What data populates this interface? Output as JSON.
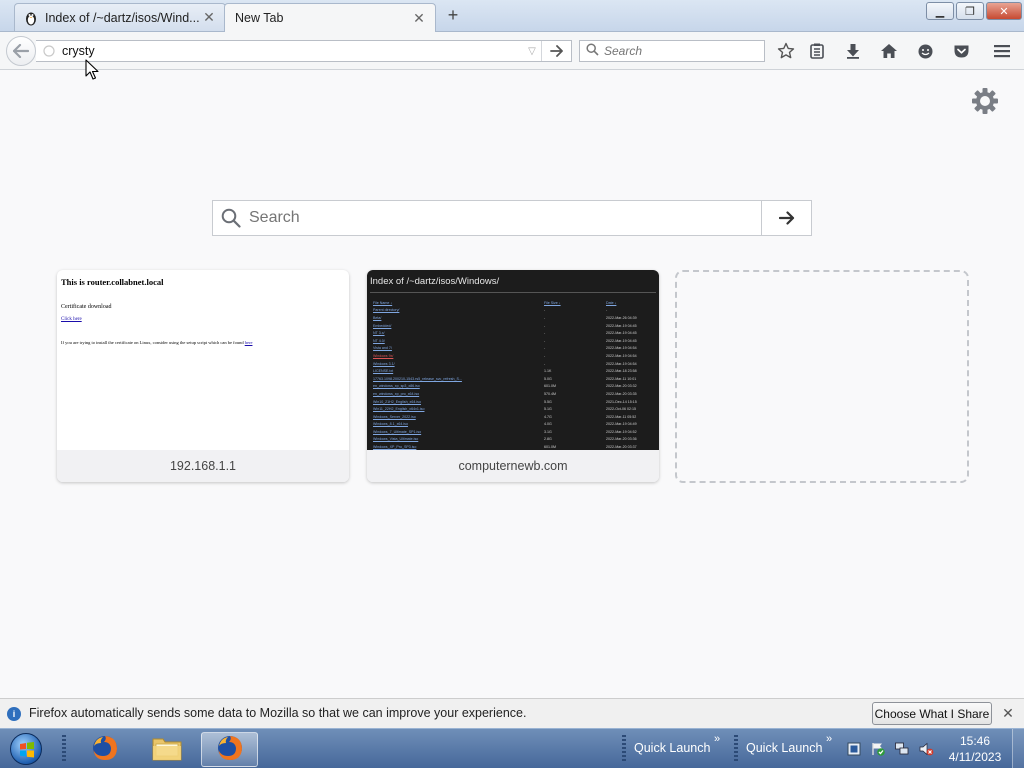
{
  "tabs": [
    {
      "title": "Index of /~dartz/isos/Wind...",
      "icon": "tux-icon",
      "active": false
    },
    {
      "title": "New Tab",
      "icon": "",
      "active": true
    }
  ],
  "navbar": {
    "url_value": "crysty",
    "search_placeholder": "Search"
  },
  "page": {
    "search_placeholder": "Search",
    "tiles": [
      {
        "label": "192.168.1.1"
      },
      {
        "label": "computernewb.com"
      }
    ]
  },
  "thumb1": {
    "heading": "This is router.collabnet.local",
    "subheading": "Certificate download",
    "link": "Click here",
    "paragraph": "If you are trying to install the certificate on Linux, consider using the setup script which can be found",
    "paragraph_link": "here"
  },
  "thumb2": {
    "heading": "Index of /~dartz/isos/Windows/",
    "columns": [
      "File Name ↓",
      "File Size ↓",
      "Date ↓"
    ],
    "rows": [
      [
        "Parent directory/",
        "-",
        "-"
      ],
      [
        "Beta/",
        "-",
        "2022-Mar-26 04:39"
      ],
      [
        "Embedded/",
        "-",
        "2022-Mar-19 04:45"
      ],
      [
        "NT 3.x/",
        "-",
        "2022-Mar-19 04:45"
      ],
      [
        "NT 4.0/",
        "-",
        "2022-Mar-19 04:45"
      ],
      [
        "Vista and 7/",
        "-",
        "2022-Mar-19 04:54"
      ],
      [
        "Windows 9x/",
        "-",
        "2022-Mar-19 04:54"
      ],
      [
        "Windows 3.1/",
        "-",
        "2022-Mar-19 04:54"
      ],
      [
        "LICENSE.txt",
        "1.1K",
        "2022-Mar-18 23:58"
      ],
      [
        "17763.1098.200210-1543.rs5_release_svc_refresh_S...",
        "5.0G",
        "2022-Mar-11 10:01"
      ],
      [
        "en_windows_xp_sp3_x86.iso",
        "601.0M",
        "2022-Mar-20 03:32"
      ],
      [
        "en_windows_xp_pro_x64.iso",
        "570.4M",
        "2022-Mar-20 03:35"
      ],
      [
        "Win10_21H2_English_x64.iso",
        "5.5G",
        "2021-Dec-14 15:15"
      ],
      [
        "Win11_22H2_English_x64v1.iso",
        "5.1G",
        "2022-Oct-06 02:15"
      ],
      [
        "Windows_Server_2022.iso",
        "4.7G",
        "2022-Mar-11 05:52"
      ],
      [
        "Windows_8.1_x64.iso",
        "4.0G",
        "2022-Mar-19 04:49"
      ],
      [
        "Windows_7_Ultimate_SP1.iso",
        "3.1G",
        "2022-Mar-19 04:52"
      ],
      [
        "Windows_Vista_Ultimate.iso",
        "2.8G",
        "2022-Mar-20 03:36"
      ],
      [
        "Windows_XP_Pro_SP3.iso",
        "601.0M",
        "2022-Mar-20 03:37"
      ],
      [
        "ReactOS.iso",
        "132.1M",
        "2022-Mar-20 03:40"
      ],
      [
        "Win2k_Pro_SP4.iso",
        "637.0M",
        "2021-Oct-24 15:11"
      ]
    ],
    "red_row_index": 6
  },
  "notification": {
    "message": "Firefox automatically sends some data to Mozilla so that we can improve your experience.",
    "button": "Choose What I Share"
  },
  "taskbar": {
    "quick_launch_1": "Quick Launch",
    "quick_launch_2": "Quick Launch",
    "time": "15:46",
    "date": "4/11/2023"
  },
  "colors": {
    "accent": "#2f6fbd",
    "taskbar": "#46689a",
    "close_button": "#c74a32"
  }
}
